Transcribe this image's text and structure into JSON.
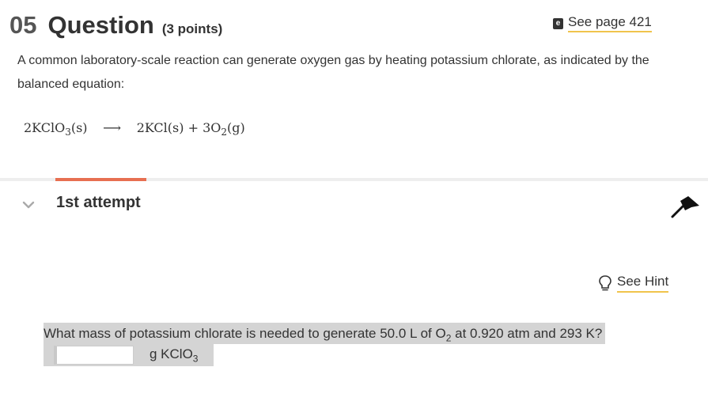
{
  "question": {
    "number": "05",
    "word": "Question",
    "points": "(3 points)"
  },
  "see_page": {
    "label": "See page 421"
  },
  "intro": "A common laboratory-scale reaction can generate oxygen gas by heating potassium chlorate, as indicated by the balanced equation:",
  "equation": {
    "reactant": "2KClO",
    "reactant_sub": "3",
    "reactant_state": "(s)",
    "arrow": "⟶",
    "product1": "2KCl(s)",
    "plus": "+",
    "product2": "3O",
    "product2_sub": "2",
    "product2_state": "(g)"
  },
  "attempt": {
    "label": "1st attempt"
  },
  "hint": {
    "label": "See Hint"
  },
  "prompt": {
    "text_before": "What mass of potassium chlorate is needed to generate 50.0 L of O",
    "sub": "2",
    "text_after": " at 0.920 atm and 293 K?"
  },
  "answer": {
    "value": "",
    "unit_prefix": "g KClO",
    "unit_sub": "3"
  },
  "colors": {
    "accent_tab": "#e76f51",
    "link_underline": "#f0c44c",
    "highlight": "#d4d4d4"
  }
}
